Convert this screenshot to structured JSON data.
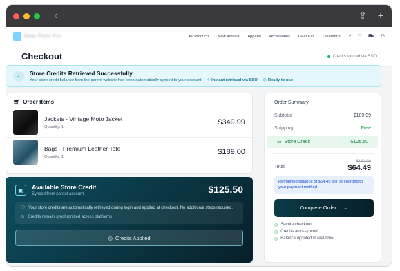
{
  "nav": {
    "logo_text": "Gear·Point Pro",
    "links": [
      "All Products",
      "New Arrivals",
      "Apparel",
      "Accessories",
      "Gear Kits",
      "Clearance"
    ]
  },
  "header": {
    "title": "Checkout",
    "sync_status": "Credits synced via SSO"
  },
  "banner": {
    "title": "Store Credits Retrieved Successfully",
    "subtitle": "Your store credit balance from the parent website has been automatically synced to your account",
    "tag_instant": "Instant retrieval via SSO",
    "tag_ready": "Ready to use"
  },
  "order_items": {
    "heading": "Order Items",
    "items": [
      {
        "name": "Jackets - Vintage Moto Jacket",
        "quantity": "Quantity: 1",
        "price": "$349.99"
      },
      {
        "name": "Bags - Premium Leather Tote",
        "quantity": "Quantity: 1",
        "price": "$189.00"
      }
    ]
  },
  "store_credit": {
    "title": "Available Store Credit",
    "subtitle": "Synced from parent account",
    "amount": "$125.50",
    "info": "Your store credits are automatically retrieved during login and applied at checkout. No additional steps required.",
    "synced_note": "Credits remain synchronized across platforms",
    "button_label": "Credits Applied"
  },
  "summary": {
    "title": "Order Summary",
    "subtotal_label": "Subtotal",
    "subtotal_value": "$189.99",
    "shipping_label": "Shipping",
    "shipping_value": "Free",
    "credit_label": "Store Credit",
    "credit_value": "-$125.50",
    "total_label": "Total",
    "total_old": "$189.99",
    "total_new": "$64.49",
    "remaining_note": "Remaining balance of $64.49 will be charged to your payment method",
    "complete_label": "Complete Order",
    "checks": [
      "Secure checkout",
      "Credits auto-synced",
      "Balance updated in real-time"
    ]
  },
  "colors": {
    "accent_teal": "#0d4e5e",
    "banner_bg": "#e6f7fb",
    "success_green": "#16a34a"
  }
}
